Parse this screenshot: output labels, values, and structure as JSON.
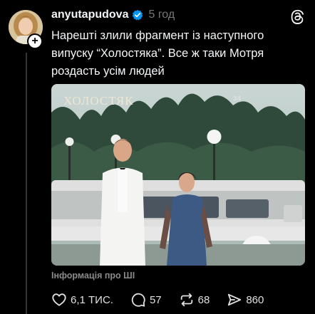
{
  "post": {
    "username": "anyutapudova",
    "time": "5 год",
    "text": "Нарешті злили фрагмент із наступного випуску “Холостяка”. Все ж таки Мотря роздасть усім людей",
    "ai_info": "Інформація про ШІ"
  },
  "media": {
    "brand": "ХОЛОСТЯК",
    "counter": "3/4"
  },
  "actions": {
    "likes": "6,1 ТИС.",
    "comments": "57",
    "reposts": "68",
    "shares": "860"
  },
  "colors": {
    "background": "#000000",
    "verified": "#0095f6",
    "muted": "#777777"
  }
}
